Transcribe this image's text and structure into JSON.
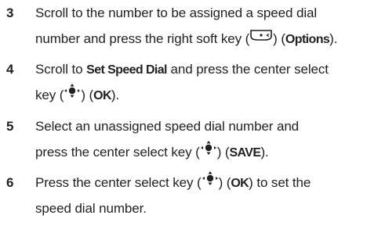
{
  "steps": [
    {
      "number": "3",
      "line1_pre": "Scroll to the number to be assigned a speed dial",
      "line2_pre": "number and press the right soft key (",
      "line2_mid": ") (",
      "line2_cmd": "Options",
      "line2_post": ").",
      "icon": "right-soft-key-icon"
    },
    {
      "number": "4",
      "line1_pre": "Scroll to ",
      "line1_cmd": "Set Speed Dial",
      "line1_post": " and press the center select",
      "line2_pre": "key (",
      "line2_mid": ") (",
      "line2_cmd": "OK",
      "line2_post": ").",
      "icon": "center-select-key-icon"
    },
    {
      "number": "5",
      "line1_pre": "Select an unassigned speed dial number and",
      "line2_pre": "press the center select key (",
      "line2_mid": ") (",
      "line2_cmd": "SAVE",
      "line2_post": ").",
      "icon": "center-select-key-icon"
    },
    {
      "number": "6",
      "line1_pre": "Press the center select key (",
      "line1_mid": ") (",
      "line1_cmd": "OK",
      "line1_post": ") to set the",
      "line2_pre": "speed dial number.",
      "icon": "center-select-key-icon"
    }
  ]
}
